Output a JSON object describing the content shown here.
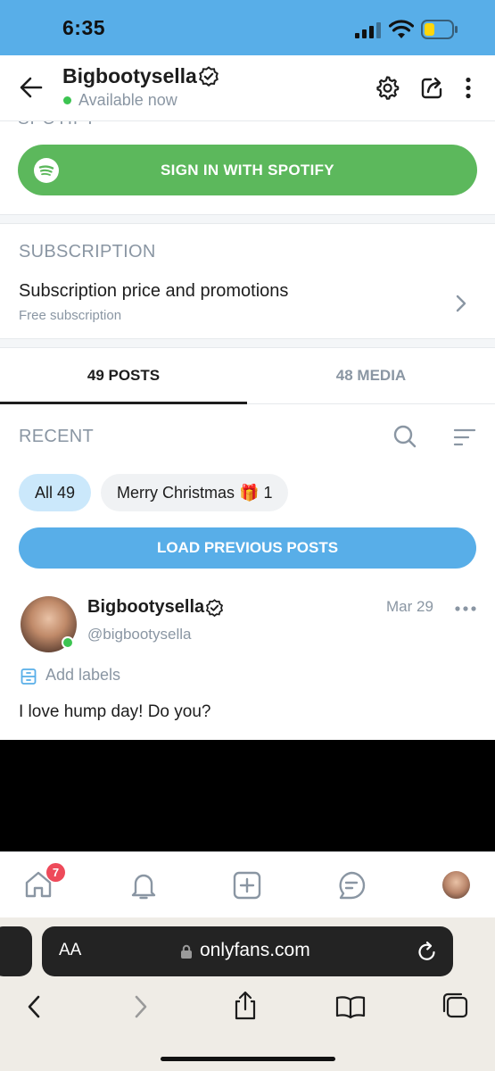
{
  "status_bar": {
    "time": "6:35",
    "battery_color": "#ffd60a"
  },
  "header": {
    "name": "Bigbootysella",
    "status": "Available now",
    "icons": [
      "back-arrow-icon",
      "verified-icon",
      "settings-icon",
      "share-icon",
      "more-vertical-icon"
    ]
  },
  "spotify": {
    "section_title_cut": "SPOTIFY",
    "button_label": "SIGN IN WITH SPOTIFY",
    "color": "#5cb85c"
  },
  "subscription": {
    "title": "SUBSCRIPTION",
    "price_label": "Subscription price and promotions",
    "price_value": "Free subscription"
  },
  "tabs": [
    {
      "label": "49 POSTS",
      "active": true
    },
    {
      "label": "48 MEDIA",
      "active": false
    }
  ],
  "recent": {
    "title": "RECENT",
    "chips": [
      {
        "label": "All 49",
        "active": true
      },
      {
        "label": "Merry Christmas",
        "emoji": "🎁",
        "count": "1",
        "active": false
      }
    ],
    "load_button": "LOAD PREVIOUS POSTS"
  },
  "post": {
    "author": "Bigbootysella",
    "handle": "@bigbootysella",
    "date": "Mar 29",
    "add_labels": "Add labels",
    "text": "I love hump day! Do you?"
  },
  "bottom_nav": {
    "home_badge": "7",
    "items": [
      "home-icon",
      "notifications-icon",
      "add-post-icon",
      "messages-icon",
      "profile-avatar"
    ]
  },
  "browser": {
    "aa_label": "AA",
    "url": "onlyfans.com"
  },
  "colors": {
    "accent": "#58aee8",
    "muted": "#8a96a3",
    "online": "#3cc451",
    "badge": "#ee4a5a"
  }
}
